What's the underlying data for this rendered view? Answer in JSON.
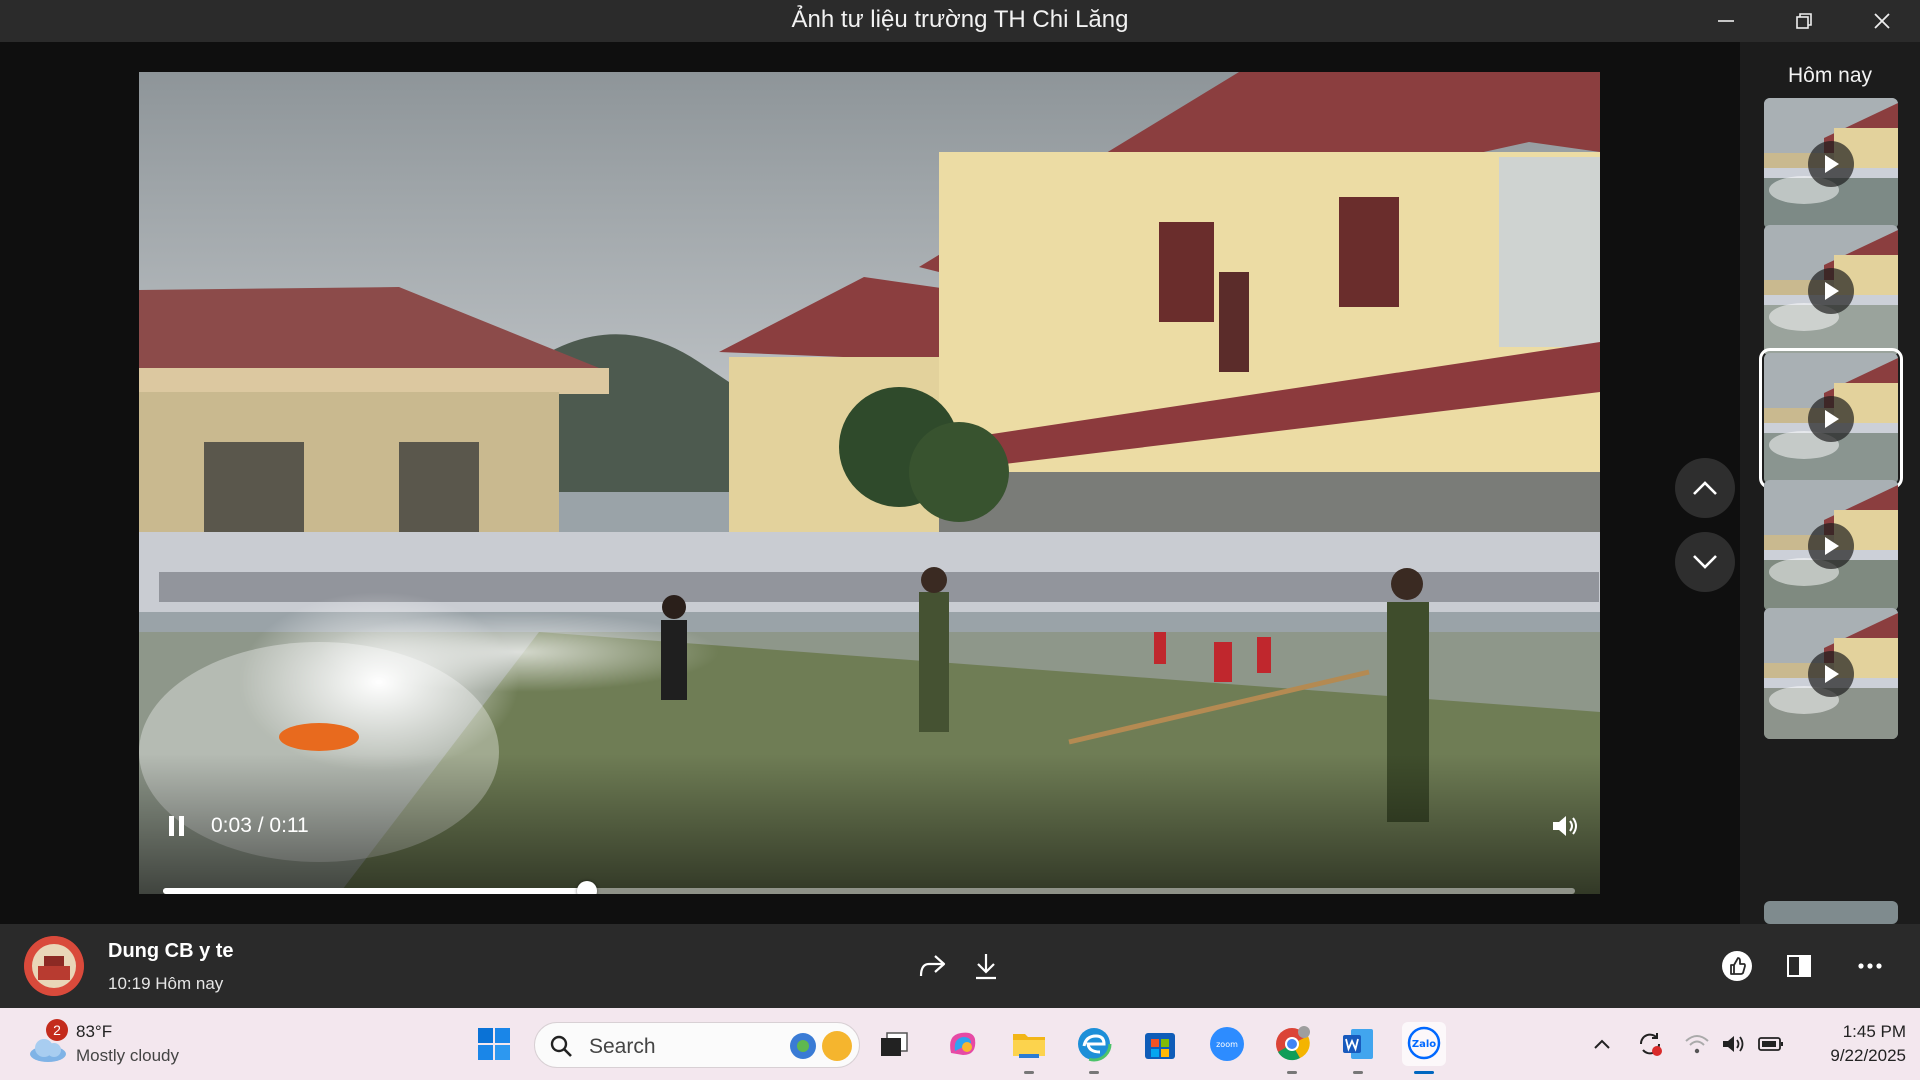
{
  "window": {
    "title": "Ảnh tư liệu trường TH Chi Lăng"
  },
  "player": {
    "current_time": "0:03",
    "duration": "0:11",
    "time_separator": " / ",
    "progress_fraction": 0.3,
    "state": "playing"
  },
  "sidebar": {
    "heading": "Hôm nay",
    "thumbnails": [
      {
        "kind": "video",
        "selected": false
      },
      {
        "kind": "video",
        "selected": false
      },
      {
        "kind": "video",
        "selected": true
      },
      {
        "kind": "video",
        "selected": false
      },
      {
        "kind": "video",
        "selected": false
      }
    ]
  },
  "info": {
    "sender": "Dung CB y te",
    "time": "10:19 Hôm nay"
  },
  "taskbar": {
    "weather": {
      "badge": "2",
      "temperature": "83°F",
      "condition": "Mostly cloudy"
    },
    "search_placeholder": "Search",
    "clock": {
      "time": "1:45 PM",
      "date": "9/22/2025"
    },
    "zoom_label": "zoom",
    "zalo_label": "Zalo"
  },
  "colors": {
    "accent": "#0067c0",
    "titlebar": "#2b2b2b",
    "taskbar": "#f3e7ee",
    "badge": "#c42b1c"
  }
}
